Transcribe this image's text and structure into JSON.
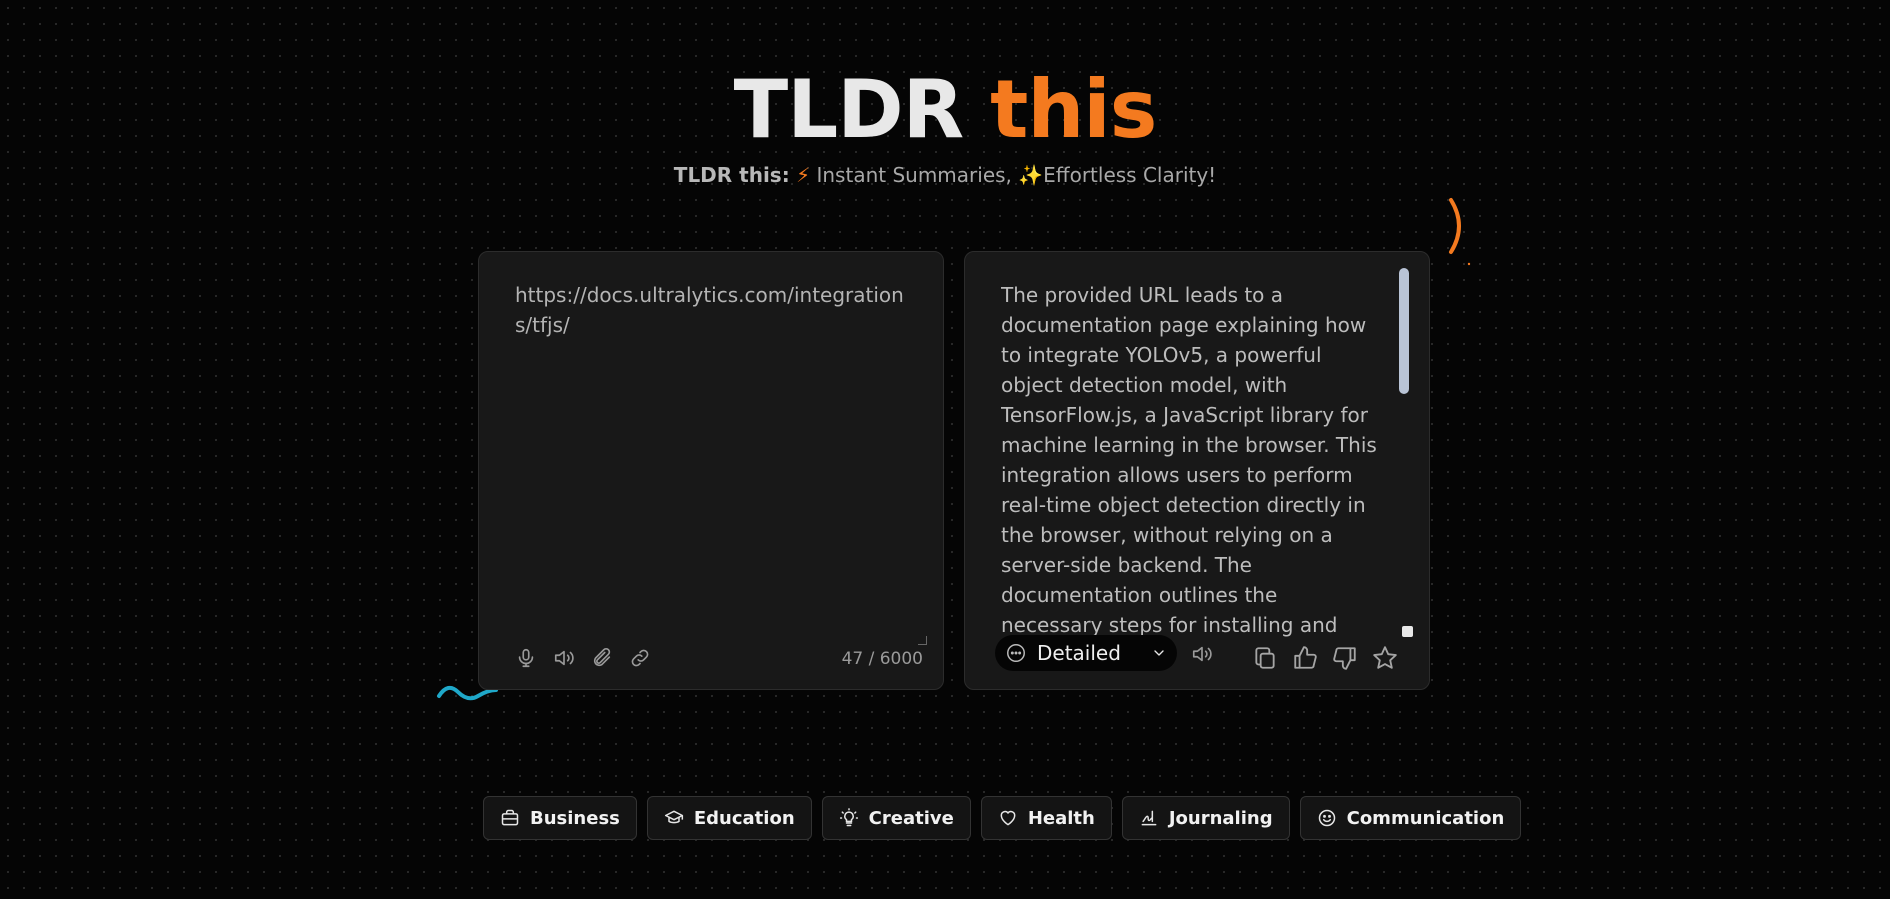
{
  "header": {
    "title_part1": "TLDR",
    "title_part2": "this",
    "subtitle_bold": "TLDR this:",
    "subtitle_emoji1": "⚡",
    "subtitle_text1": " Instant Summaries, ",
    "subtitle_emoji2": "✨",
    "subtitle_text2": "Effortless Clarity!"
  },
  "input_panel": {
    "text": "https://docs.ultralytics.com/integrations/tfjs/",
    "char_count": "47 / 6000",
    "tools": [
      "mic-icon",
      "speaker-icon",
      "attach-icon",
      "link-icon"
    ]
  },
  "output_panel": {
    "text": "The provided URL leads to a documentation page explaining how to integrate YOLOv5, a powerful object detection model, with TensorFlow.js, a JavaScript library for machine learning in the browser. This integration allows users to perform real-time object detection directly in the browser, without relying on a server-side backend. The documentation outlines the necessary steps for installing and setting up the required libraries, as well",
    "mode_selected": "Detailed",
    "actions": [
      "copy-icon",
      "thumbs-up-icon",
      "thumbs-down-icon",
      "star-icon"
    ]
  },
  "categories": [
    {
      "label": "Business",
      "icon": "briefcase-icon"
    },
    {
      "label": "Education",
      "icon": "graduation-cap-icon"
    },
    {
      "label": "Creative",
      "icon": "lightbulb-icon"
    },
    {
      "label": "Health",
      "icon": "heart-icon"
    },
    {
      "label": "Journaling",
      "icon": "signature-icon"
    },
    {
      "label": "Communication",
      "icon": "smile-icon"
    }
  ],
  "colors": {
    "accent_orange": "#f47a1f",
    "accent_cyan": "#1fa8c9",
    "background": "#050505",
    "panel": "#181818"
  }
}
